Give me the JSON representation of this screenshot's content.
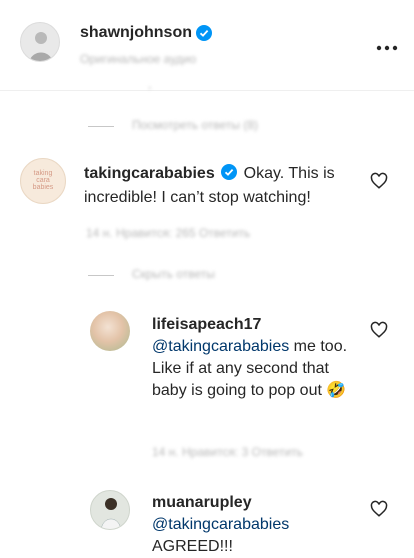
{
  "header": {
    "username": "shawnjohnson",
    "subtitle_blurred": "Оригинальное аудио",
    "more_icon": "more-horizontal-icon"
  },
  "top_view_replies": "Посмотреть ответы (8)",
  "comments": [
    {
      "username": "takingcarababies",
      "avatar_text": [
        "taking",
        "cara",
        "babies"
      ],
      "text": "Okay. This is incredible! I can’t stop watching!",
      "meta_blurred": "14 н.    Нравится: 265    Ответить",
      "hide_replies_blurred": "Скрыть ответы",
      "replies": [
        {
          "username": "lifeisapeach17",
          "mention": "@takingcarababies",
          "text": "me too. Like if at any second that baby is going to pop out",
          "emoji": "🤣",
          "meta_blurred": "14 н.    Нравится: 3    Ответить"
        },
        {
          "username": "muanarupley",
          "mention": "@takingcarababies",
          "text": "AGREED!!!"
        }
      ]
    }
  ],
  "colors": {
    "accent": "#0095f6",
    "mention": "#00376b",
    "muted": "#8e8e8e"
  }
}
